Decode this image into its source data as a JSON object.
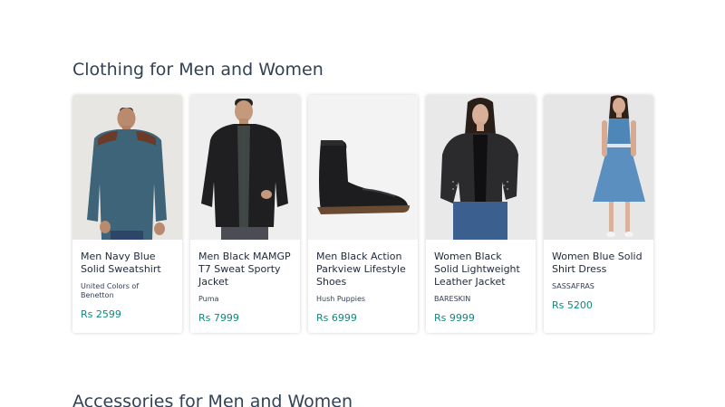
{
  "sections": [
    {
      "title": "Clothing for Men and Women",
      "products": [
        {
          "name": "Men Navy Blue Solid Sweatshirt",
          "brand": "United Colors of Benetton",
          "price": "Rs 2599"
        },
        {
          "name": "Men Black MAMGP T7 Sweat Sporty Jacket",
          "brand": "Puma",
          "price": "Rs 7999"
        },
        {
          "name": "Men Black Action Parkview Lifestyle Shoes",
          "brand": "Hush Puppies",
          "price": "Rs 6999"
        },
        {
          "name": "Women Black Solid Lightweight Leather Jacket",
          "brand": "BARESKIN",
          "price": "Rs 9999"
        },
        {
          "name": "Women Blue Solid Shirt Dress",
          "brand": "SASSAFRAS",
          "price": "Rs 5200"
        }
      ]
    },
    {
      "title": "Accessories for Men and Women"
    }
  ],
  "colors": {
    "price": "#0f8a7e",
    "title": "#334155"
  }
}
